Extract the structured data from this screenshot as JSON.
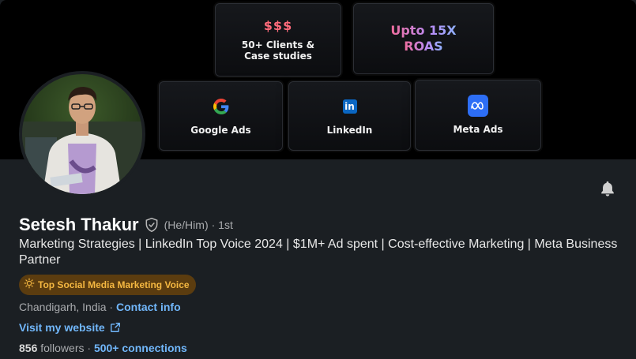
{
  "banner": {
    "cards": [
      {
        "id": "clients",
        "big": "$$$",
        "label1": "50+ Clients &",
        "label2": "Case studies"
      },
      {
        "id": "roas",
        "line1": "Upto 15X",
        "line2": "ROAS"
      },
      {
        "id": "google",
        "label": "Google Ads",
        "icon": "google-icon"
      },
      {
        "id": "linkedin",
        "label": "LinkedIn",
        "icon": "linkedin-icon",
        "icon_text": "in"
      },
      {
        "id": "meta",
        "label": "Meta Ads",
        "icon": "meta-icon"
      }
    ]
  },
  "profile": {
    "name": "Setesh Thakur",
    "pronouns": "(He/Him)",
    "degree": "· 1st",
    "headline": "Marketing Strategies | LinkedIn Top Voice 2024 | $1M+ Ad spent | Cost-effective Marketing | Meta Business Partner",
    "badge": "Top Social Media Marketing Voice",
    "location": "Chandigarh, India",
    "separator": " · ",
    "contact_info": "Contact info",
    "website": "Visit my website",
    "followers_count": "856",
    "followers_label": " followers",
    "stats_separator": " · ",
    "connections": "500+ connections"
  },
  "colors": {
    "link": "#71b7fb",
    "badge_bg": "#5b3c0f",
    "badge_text": "#f4b741",
    "background": "#1b1f23"
  }
}
